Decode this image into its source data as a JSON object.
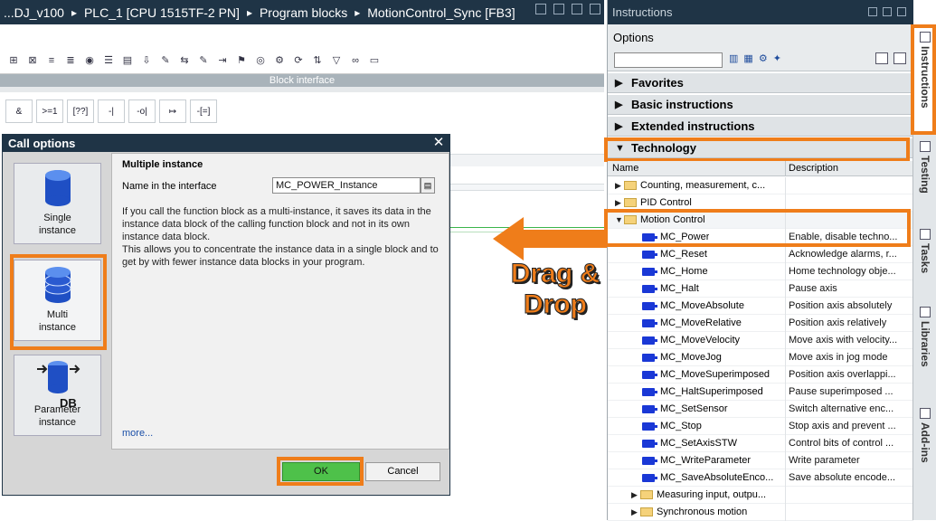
{
  "breadcrumb": [
    "...DJ_v100",
    "PLC_1 [CPU 1515TF-2 PN]",
    "Program blocks",
    "MotionControl_Sync [FB3]"
  ],
  "editor": {
    "block_interface_label": "Block interface",
    "lad_buttons": [
      "&",
      ">=1",
      "[??]",
      "-|",
      "-o|",
      "↦",
      "-[=]"
    ]
  },
  "dialog": {
    "title": "Call options",
    "options": [
      {
        "label": "Single instance"
      },
      {
        "label": "Multi instance",
        "selected": true
      },
      {
        "label": "Parameter instance",
        "tag": "DB"
      }
    ],
    "pane_title": "Multiple instance",
    "name_label": "Name in the interface",
    "name_value": "MC_POWER_Instance",
    "description": "If you call the function block as a multi-instance, it saves its data in the instance data block of the calling function block and not in its own instance data block.\nThis allows you to concentrate the instance data in a single block and to get by with fewer instance data blocks in your program.",
    "more_link": "more...",
    "ok_label": "OK",
    "cancel_label": "Cancel"
  },
  "annotation": {
    "line1": "Drag &",
    "line2": "Drop",
    "color": "#ef7d1a"
  },
  "instructions_panel": {
    "title": "Instructions",
    "options_label": "Options",
    "sections": [
      {
        "label": "Favorites",
        "expanded": false
      },
      {
        "label": "Basic instructions",
        "expanded": false
      },
      {
        "label": "Extended instructions",
        "expanded": false
      },
      {
        "label": "Technology",
        "expanded": true
      }
    ],
    "columns": {
      "name": "Name",
      "description": "Description"
    },
    "rows": [
      {
        "name": "Counting, measurement, c...",
        "desc": "",
        "type": "folder",
        "level": 0,
        "exp": "▶"
      },
      {
        "name": "PID Control",
        "desc": "",
        "type": "folder",
        "level": 0,
        "exp": "▶"
      },
      {
        "name": "Motion Control",
        "desc": "",
        "type": "folder",
        "level": 0,
        "exp": "▼"
      },
      {
        "name": "MC_Power",
        "desc": "Enable, disable techno...",
        "type": "block",
        "level": 1
      },
      {
        "name": "MC_Reset",
        "desc": "Acknowledge alarms, r...",
        "type": "block",
        "level": 1
      },
      {
        "name": "MC_Home",
        "desc": "Home technology obje...",
        "type": "block",
        "level": 1
      },
      {
        "name": "MC_Halt",
        "desc": "Pause axis",
        "type": "block",
        "level": 1
      },
      {
        "name": "MC_MoveAbsolute",
        "desc": "Position axis absolutely",
        "type": "block",
        "level": 1
      },
      {
        "name": "MC_MoveRelative",
        "desc": "Position axis relatively",
        "type": "block",
        "level": 1
      },
      {
        "name": "MC_MoveVelocity",
        "desc": "Move axis with velocity...",
        "type": "block",
        "level": 1
      },
      {
        "name": "MC_MoveJog",
        "desc": "Move axis in jog mode",
        "type": "block",
        "level": 1
      },
      {
        "name": "MC_MoveSuperimposed",
        "desc": "Position axis overlappi...",
        "type": "block",
        "level": 1
      },
      {
        "name": "MC_HaltSuperimposed",
        "desc": "Pause superimposed ...",
        "type": "block",
        "level": 1
      },
      {
        "name": "MC_SetSensor",
        "desc": "Switch alternative enc...",
        "type": "block",
        "level": 1
      },
      {
        "name": "MC_Stop",
        "desc": "Stop axis and prevent ...",
        "type": "block",
        "level": 1
      },
      {
        "name": "MC_SetAxisSTW",
        "desc": "Control bits of control ...",
        "type": "block",
        "level": 1
      },
      {
        "name": "MC_WriteParameter",
        "desc": "Write parameter",
        "type": "block",
        "level": 1
      },
      {
        "name": "MC_SaveAbsoluteEnco...",
        "desc": "Save absolute encode...",
        "type": "block",
        "level": 1
      },
      {
        "name": "Measuring input, outpu...",
        "desc": "",
        "type": "folder",
        "level": 1,
        "exp": "▶"
      },
      {
        "name": "Synchronous motion",
        "desc": "",
        "type": "folder",
        "level": 1,
        "exp": "▶"
      }
    ]
  },
  "side_tabs": [
    "Instructions",
    "Testing",
    "Tasks",
    "Libraries",
    "Add-ins"
  ],
  "colors": {
    "highlight": "#ef7d1a",
    "titlebar": "#1f3446",
    "ok_green": "#4ec14a"
  }
}
